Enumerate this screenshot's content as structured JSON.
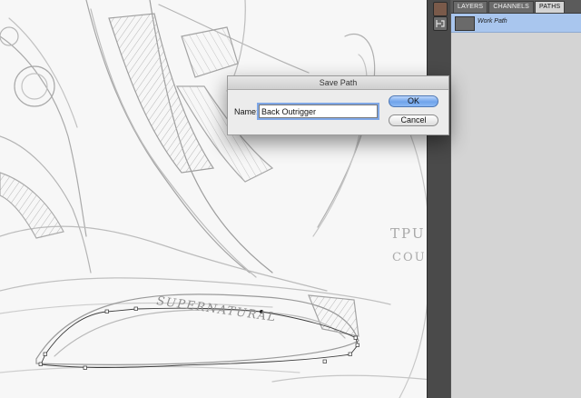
{
  "canvas": {
    "sketch_label_1": "SUPERNATURAL",
    "sketch_label_2": "TPU H",
    "sketch_label_3": "COUNTE"
  },
  "panels": {
    "tabs": [
      {
        "label": "LAYERS",
        "active": false
      },
      {
        "label": "CHANNELS",
        "active": false
      },
      {
        "label": "PATHS",
        "active": true
      }
    ],
    "paths": [
      {
        "name": "Work Path",
        "selected": true
      }
    ],
    "tool_icons": [
      "brush-presets-icon",
      "clone-source-icon"
    ]
  },
  "dialog": {
    "title": "Save Path",
    "name_label": "Name:",
    "name_value": "Back Outrigger",
    "ok_label": "OK",
    "cancel_label": "Cancel"
  },
  "colors": {
    "selection": "#a9c6ee",
    "ok_button": "#6fa3ea",
    "panel_bg": "#d4d4d4",
    "canvas_bg": "#f7f7f7"
  }
}
